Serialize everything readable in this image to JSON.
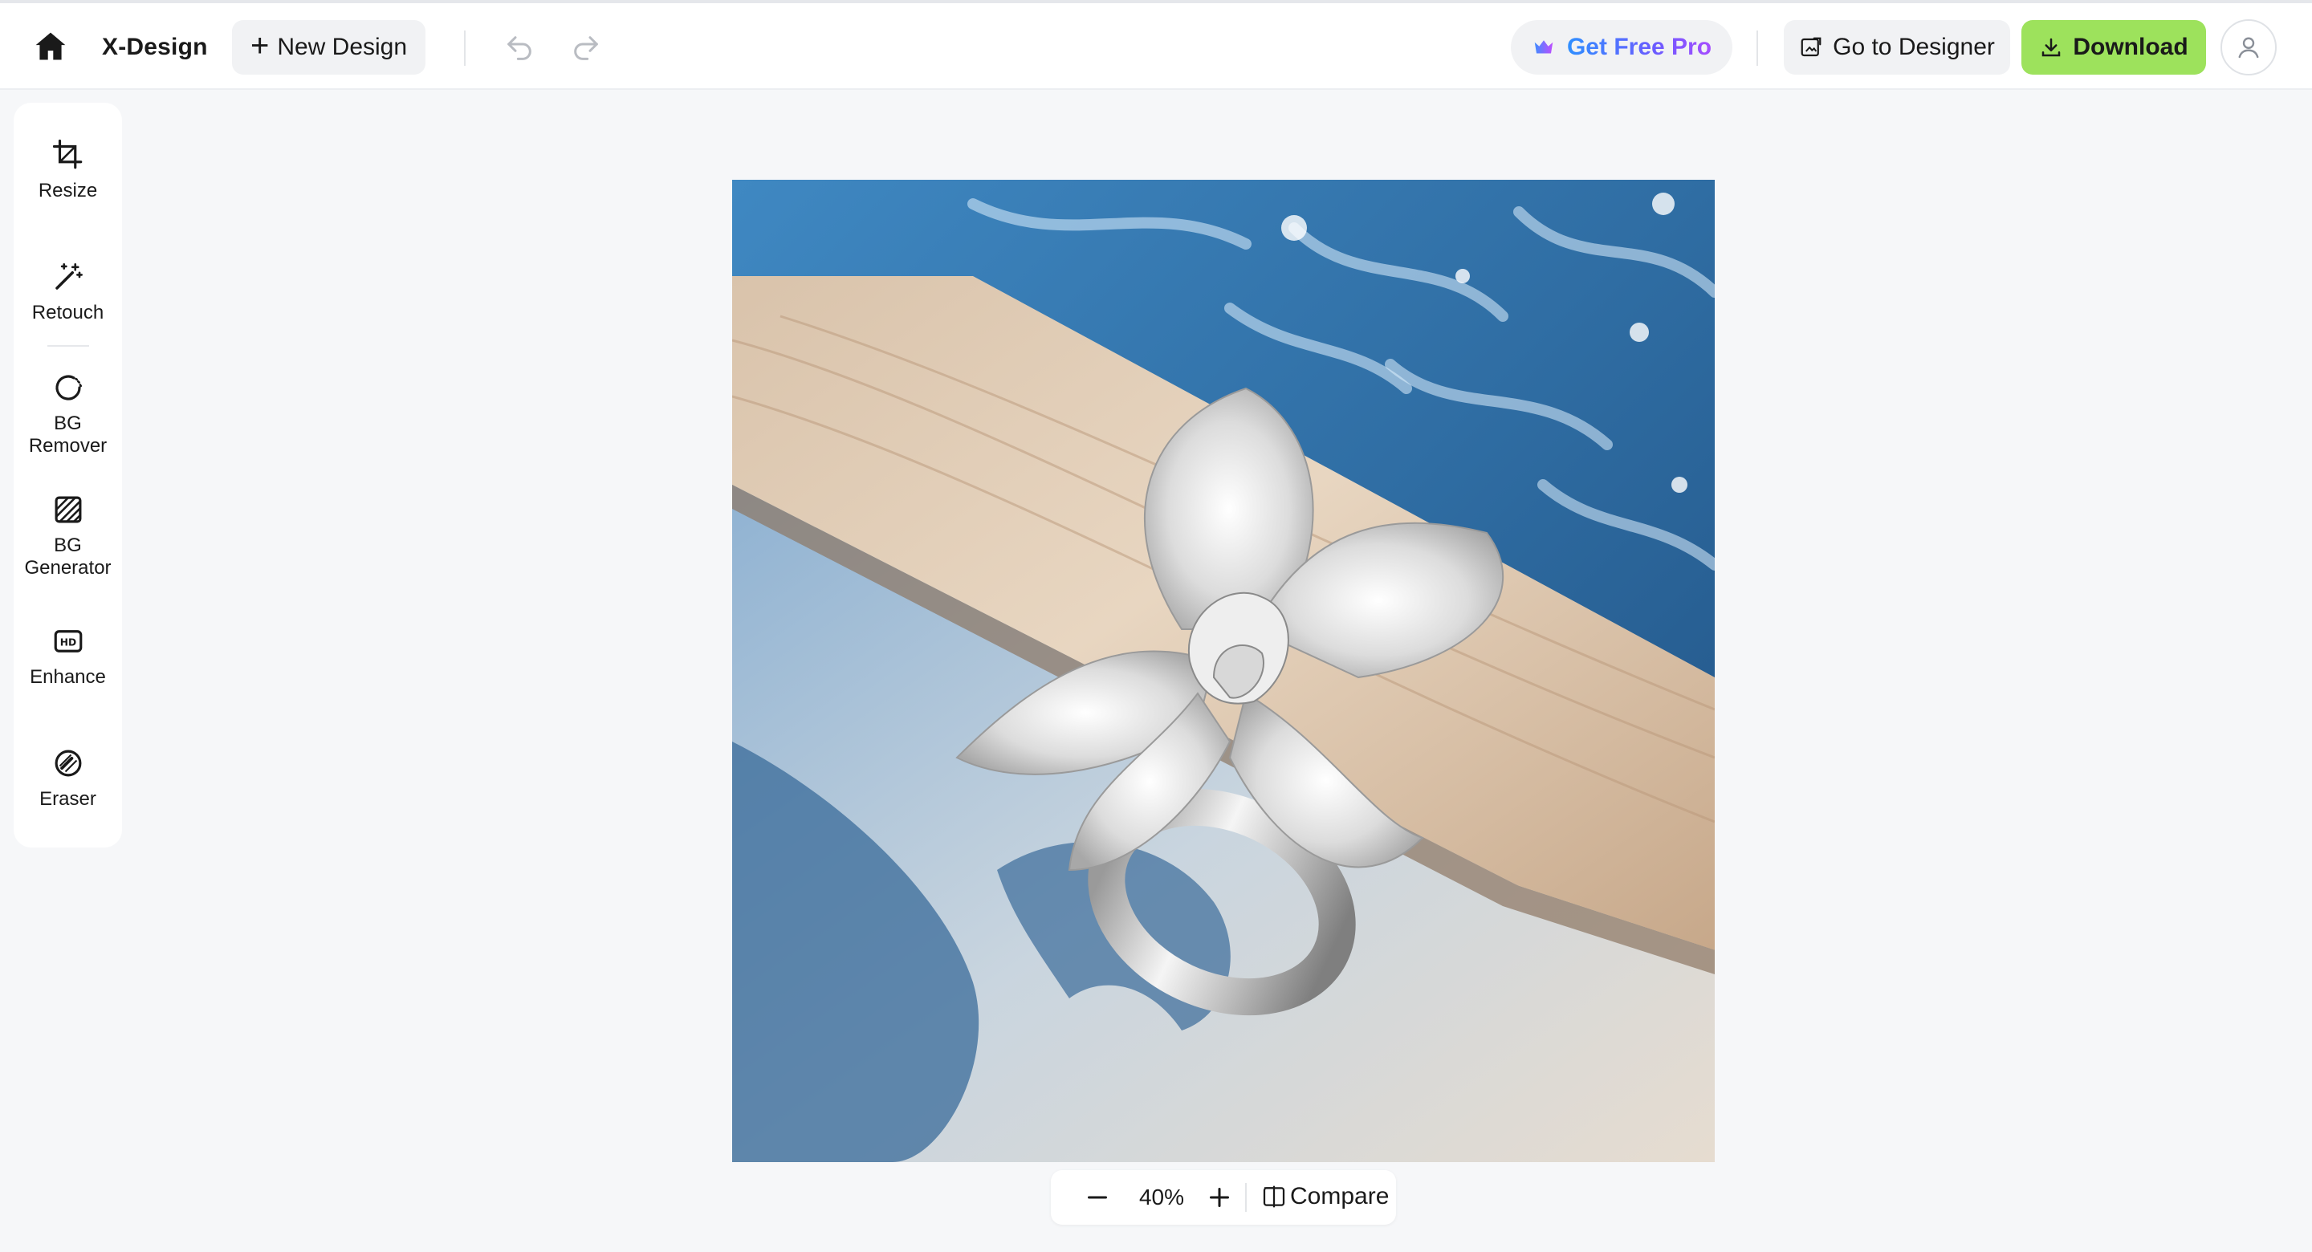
{
  "header": {
    "brand": "X-Design",
    "new_design_label": "New Design",
    "get_pro_label": "Get Free Pro",
    "go_designer_label": "Go to Designer",
    "download_label": "Download"
  },
  "toolbar": {
    "items": [
      {
        "label": "Resize",
        "icon": "crop-icon"
      },
      {
        "label": "Retouch",
        "icon": "magic-wand-icon"
      },
      {
        "label": "BG Remover",
        "icon": "bg-remover-icon"
      },
      {
        "label": "BG Generator",
        "icon": "hatch-square-icon"
      },
      {
        "label": "Enhance",
        "icon": "hd-icon"
      },
      {
        "label": "Eraser",
        "icon": "eraser-icon"
      }
    ]
  },
  "zoom": {
    "value": "40%",
    "compare_label": "Compare"
  },
  "colors": {
    "accent_download": "#9de25c",
    "pro_gradient_start": "#2f8fff",
    "pro_gradient_end": "#a64dff",
    "app_background": "#f6f7f9"
  }
}
